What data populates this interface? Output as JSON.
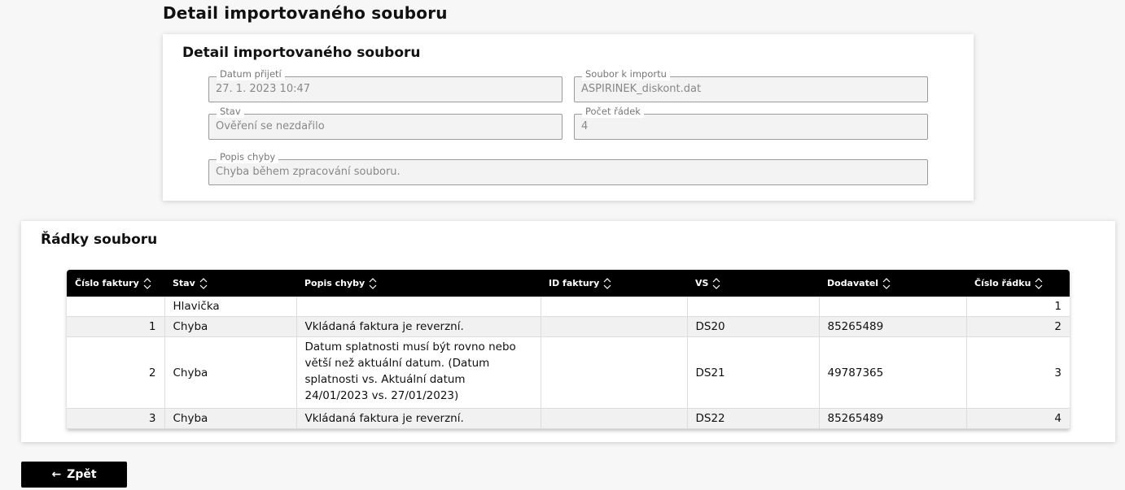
{
  "page": {
    "title": "Detail importovaného souboru"
  },
  "detail": {
    "title": "Detail importovaného souboru",
    "fields": {
      "datum_prijeti": {
        "label": "Datum přijetí",
        "value": "27. 1. 2023 10:47"
      },
      "soubor": {
        "label": "Soubor k importu",
        "value": "ASPIRINEK_diskont.dat"
      },
      "stav": {
        "label": "Stav",
        "value": "Ověření se nezdařilo"
      },
      "pocet_radek": {
        "label": "Počet řádek",
        "value": "4"
      },
      "popis_chyby": {
        "label": "Popis chyby",
        "value": "Chyba během zpracování souboru."
      }
    }
  },
  "rows_section": {
    "title": "Řádky souboru",
    "columns": [
      "Číslo faktury",
      "Stav",
      "Popis chyby",
      "ID faktury",
      "VS",
      "Dodavatel",
      "Číslo řádku"
    ],
    "rows": [
      {
        "cislo_faktury": "",
        "stav": "Hlavička",
        "popis": "",
        "id_faktury": "",
        "vs": "",
        "dodavatel": "",
        "cislo_radku": "1"
      },
      {
        "cislo_faktury": "1",
        "stav": "Chyba",
        "popis": "Vkládaná faktura je reverzní.",
        "id_faktury": "",
        "vs": "DS20",
        "dodavatel": "85265489",
        "cislo_radku": "2"
      },
      {
        "cislo_faktury": "2",
        "stav": "Chyba",
        "popis": "Datum splatnosti musí být rovno nebo větší než aktuální datum. (Datum splatnosti vs. Aktuální datum 24/01/2023 vs. 27/01/2023)",
        "id_faktury": "",
        "vs": "DS21",
        "dodavatel": "49787365",
        "cislo_radku": "3"
      },
      {
        "cislo_faktury": "3",
        "stav": "Chyba",
        "popis": "Vkládaná faktura je reverzní.",
        "id_faktury": "",
        "vs": "DS22",
        "dodavatel": "85265489",
        "cislo_radku": "4"
      }
    ]
  },
  "back_button": {
    "label": "Zpět",
    "icon": "arrow-left-icon"
  },
  "colors": {
    "header_bg": "#000000",
    "button_bg": "#000000",
    "stripe": "#f1f1f1"
  }
}
